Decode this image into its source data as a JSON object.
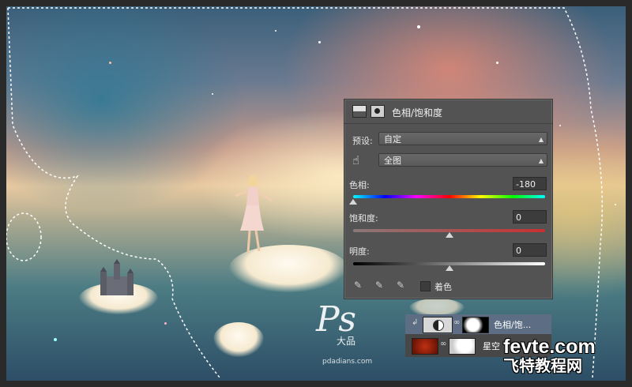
{
  "panel": {
    "title": "色相/饱和度",
    "preset_label": "预设:",
    "preset_value": "自定",
    "channel_value": "全图",
    "hue_label": "色相:",
    "hue_value": "-180",
    "hue_level": 0.0,
    "saturation_label": "饱和度:",
    "saturation_value": "0",
    "saturation_level": 0.5,
    "lightness_label": "明度:",
    "lightness_value": "0",
    "lightness_level": 0.5,
    "colorize_label": "着色",
    "colorize_checked": false
  },
  "layers": {
    "adjustment_layer_name": "色相/饱...",
    "image_layer_name": "星空"
  },
  "watermark": {
    "ps_logo": "Ps",
    "ps_sub": "大品",
    "ps_url": "pdadians.com",
    "site_logo": "fevte.com",
    "site_sub": "飞特教程网"
  },
  "icons": [
    "adjustment-icon",
    "mask-icon",
    "hand-tool-icon",
    "eyedropper-icon",
    "eyedropper-plus-icon",
    "eyedropper-minus-icon",
    "clip-arrow-icon",
    "link-icon"
  ]
}
